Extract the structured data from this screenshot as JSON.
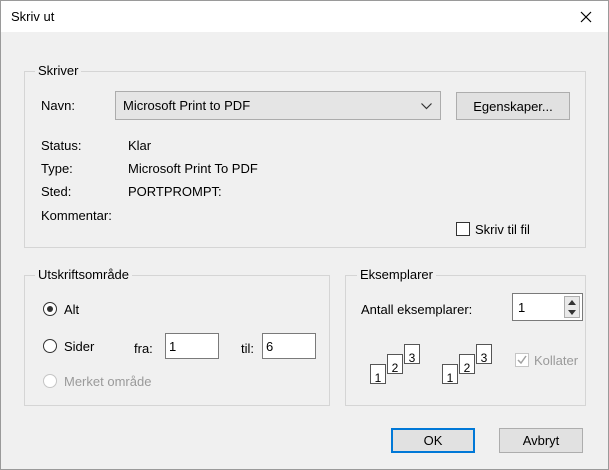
{
  "window": {
    "title": "Skriv ut"
  },
  "printer": {
    "group_label": "Skriver",
    "name_label": "Navn:",
    "name_value": "Microsoft Print to PDF",
    "properties_button": "Egenskaper...",
    "status_label": "Status:",
    "status_value": "Klar",
    "type_label": "Type:",
    "type_value": "Microsoft Print To PDF",
    "location_label": "Sted:",
    "location_value": "PORTPROMPT:",
    "comment_label": "Kommentar:",
    "print_to_file_label": "Skriv til fil",
    "print_to_file_checked": false
  },
  "range": {
    "group_label": "Utskriftsområde",
    "all_label": "Alt",
    "pages_label": "Sider",
    "from_label": "fra:",
    "from_value": "1",
    "to_label": "til:",
    "to_value": "6",
    "selection_label": "Merket område",
    "selected": "all"
  },
  "copies": {
    "group_label": "Eksemplarer",
    "count_label": "Antall eksemplarer:",
    "count_value": "1",
    "collate_label": "Kollater",
    "collate_checked": true,
    "collate_pages": [
      "1",
      "2",
      "3"
    ]
  },
  "buttons": {
    "ok": "OK",
    "cancel": "Avbryt"
  },
  "colors": {
    "accent": "#0078d7",
    "background": "#f0f0f0",
    "disabled_text": "#9a9a9a"
  }
}
